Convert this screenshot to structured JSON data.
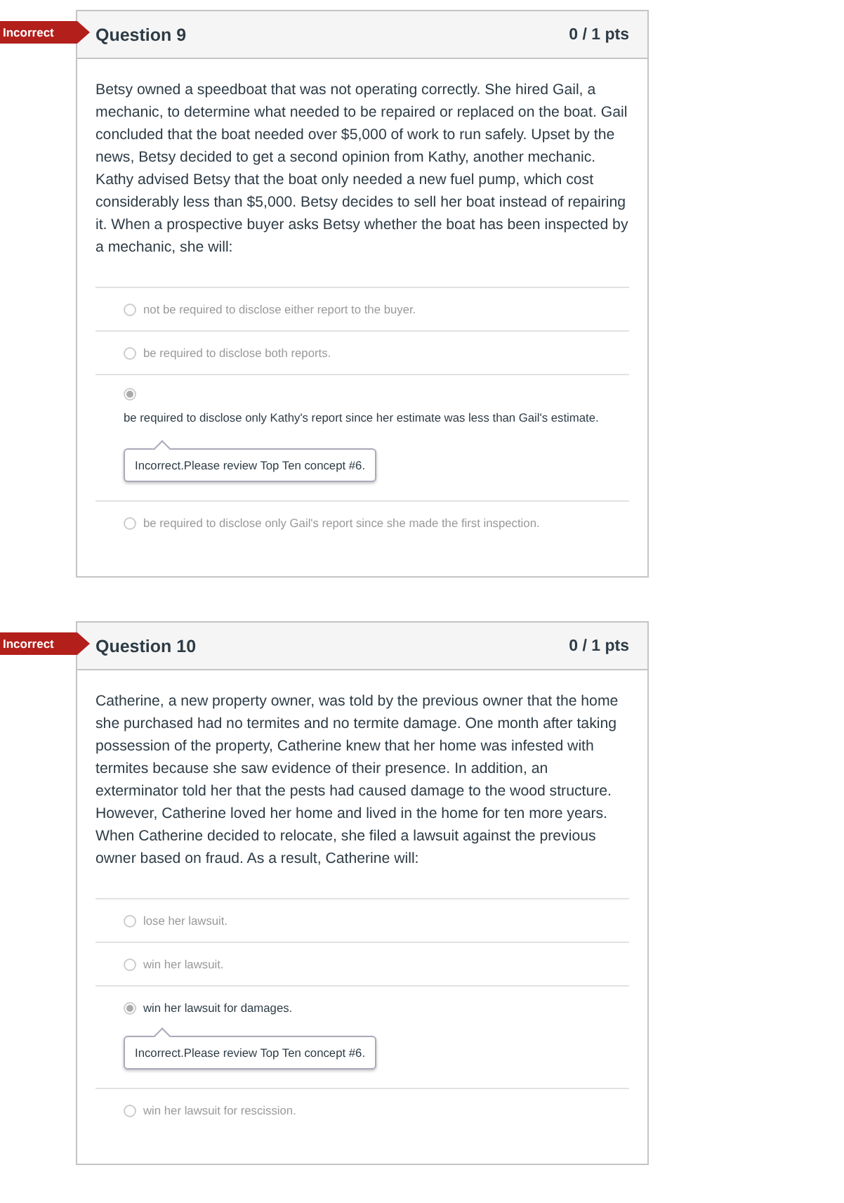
{
  "questions": [
    {
      "status": "Incorrect",
      "title": "Question 9",
      "points": "0 / 1 pts",
      "text": "Betsy owned a speedboat that was not operating correctly. She hired Gail, a mechanic, to determine what needed to be repaired or replaced on the boat. Gail concluded that the boat needed over $5,000 of work to run safely. Upset by the news, Betsy decided to get a second opinion from Kathy, another mechanic. Kathy advised Betsy that the boat only needed a new fuel pump, which cost considerably less than $5,000. Betsy decides to sell her boat instead of repairing it. When a prospective buyer asks Betsy whether the boat has been inspected by a mechanic, she will:",
      "answers": [
        {
          "kind": "inline",
          "text": "not be required to disclose either report to the buyer.",
          "selected": false
        },
        {
          "kind": "inline",
          "text": "be required to disclose both reports.",
          "selected": false
        },
        {
          "kind": "stacked",
          "text": "be required to disclose only Kathy's report since her estimate was less than Gail's estimate.",
          "selected": true,
          "feedback": "Incorrect.Please review Top Ten concept #6."
        },
        {
          "kind": "inline",
          "text": "be required to disclose only Gail's report since she made the first inspection.",
          "selected": false
        }
      ]
    },
    {
      "status": "Incorrect",
      "title": "Question 10",
      "points": "0 / 1 pts",
      "text": "Catherine, a new property owner, was told by the previous owner that the home she purchased had no termites and no termite damage. One month after taking possession of the property, Catherine knew that her home was infested with termites because she saw evidence of their presence. In addition, an exterminator told her that the pests had caused damage to the wood structure. However, Catherine loved her home and lived in the home for ten more years. When Catherine decided to relocate, she filed a lawsuit against the previous owner based on fraud. As a result, Catherine will:",
      "answers": [
        {
          "kind": "inline",
          "text": "lose her lawsuit.",
          "selected": false
        },
        {
          "kind": "inline",
          "text": "win her lawsuit.",
          "selected": false
        },
        {
          "kind": "inline",
          "text": "win her lawsuit for damages.",
          "selected": true,
          "feedback": "Incorrect.Please review Top Ten concept #6."
        },
        {
          "kind": "inline",
          "text": "win her lawsuit for rescission.",
          "selected": false
        }
      ]
    }
  ]
}
